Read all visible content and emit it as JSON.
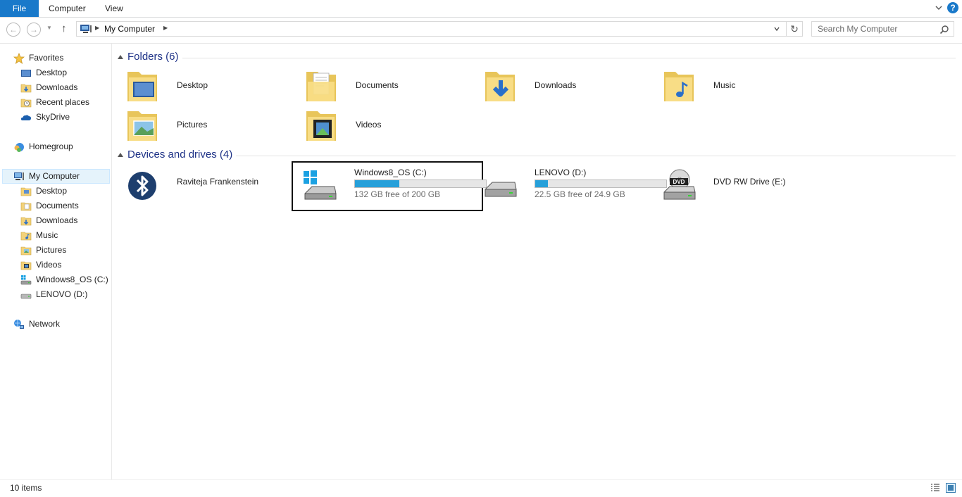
{
  "ribbon": {
    "tabs": [
      "File",
      "Computer",
      "View"
    ],
    "help": "?"
  },
  "nav": {
    "address": "My Computer",
    "search_placeholder": "Search My Computer"
  },
  "sidebar": {
    "favorites": {
      "label": "Favorites",
      "items": [
        "Desktop",
        "Downloads",
        "Recent places",
        "SkyDrive"
      ]
    },
    "homegroup": "Homegroup",
    "computer": {
      "label": "My Computer",
      "items": [
        "Desktop",
        "Documents",
        "Downloads",
        "Music",
        "Pictures",
        "Videos",
        "Windows8_OS (C:)",
        "LENOVO (D:)"
      ]
    },
    "network": "Network"
  },
  "content": {
    "folders": {
      "title": "Folders (6)",
      "items": [
        "Desktop",
        "Documents",
        "Downloads",
        "Music",
        "Pictures",
        "Videos"
      ]
    },
    "devices": {
      "title": "Devices and drives (4)",
      "items": [
        {
          "name": "Raviteja Frankenstein",
          "icon": "bluetooth-icon"
        },
        {
          "name": "Windows8_OS (C:)",
          "free_text": "132 GB free of 200 GB",
          "used_fraction": 0.34,
          "icon": "windows-drive-icon"
        },
        {
          "name": "LENOVO (D:)",
          "free_text": "22.5 GB free of 24.9 GB",
          "used_fraction": 0.096,
          "icon": "hard-drive-icon"
        },
        {
          "name": "DVD RW Drive (E:)",
          "icon": "dvd-drive-icon"
        }
      ]
    }
  },
  "status": {
    "items": "10 items"
  },
  "colors": {
    "accent": "#1979ca",
    "group_title": "#1e3287",
    "bar_fill": "#26a0da"
  }
}
